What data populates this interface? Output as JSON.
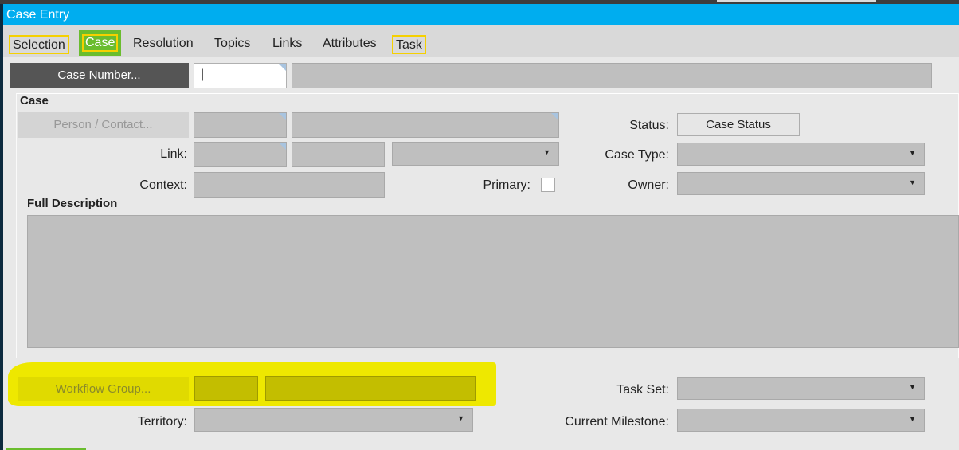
{
  "window": {
    "title": "Case Entry"
  },
  "tabs": [
    {
      "label": "Selection"
    },
    {
      "label": "Case"
    },
    {
      "label": "Resolution"
    },
    {
      "label": "Topics"
    },
    {
      "label": "Links"
    },
    {
      "label": "Attributes"
    },
    {
      "label": "Task"
    }
  ],
  "case_number": {
    "button": "Case Number...",
    "value": "|"
  },
  "case_group": {
    "title": "Case",
    "person_button": "Person / Contact...",
    "link_label": "Link:",
    "context_label": "Context:",
    "primary_label": "Primary:",
    "status_label": "Status:",
    "status_button": "Case Status",
    "case_type_label": "Case Type:",
    "owner_label": "Owner:"
  },
  "description": {
    "title": "Full Description"
  },
  "bottom": {
    "workflow_button": "Workflow Group...",
    "territory_label": "Territory:",
    "task_set_label": "Task Set:",
    "milestone_label": "Current Milestone:"
  },
  "colors": {
    "titlebar": "#00adef",
    "active_tab": "#6abd2e",
    "highlight": "#eee800"
  }
}
